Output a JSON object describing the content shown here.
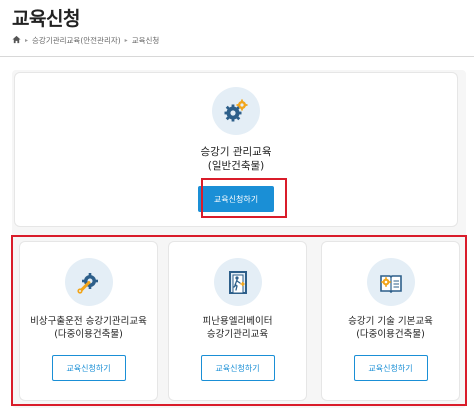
{
  "header": {
    "title": "교육신청",
    "breadcrumb": [
      "승강기관리교육(안전관리자)",
      "교육신청"
    ]
  },
  "top_card": {
    "icon": "gears-icon",
    "title_line1": "승강기 관리교육",
    "title_line2": "(일반건축물)",
    "button_label": "교육신청하기"
  },
  "cards": [
    {
      "icon": "wrench-gear-icon",
      "title_line1": "비상구출운전 승강기관리교육",
      "title_line2": "(다중이용건축물)",
      "button_label": "교육신청하기"
    },
    {
      "icon": "elevator-exit-icon",
      "title_line1": "피난용엘리베이터",
      "title_line2": "승강기관리교육",
      "button_label": "교육신청하기"
    },
    {
      "icon": "book-gear-icon",
      "title_line1": "승강기 기술 기본교육",
      "title_line2": "(다중이용건축물)",
      "button_label": "교육신청하기"
    }
  ],
  "colors": {
    "accent": "#1a8fd6",
    "highlight": "#d91c2a",
    "icon_bg": "#e4eef6"
  }
}
